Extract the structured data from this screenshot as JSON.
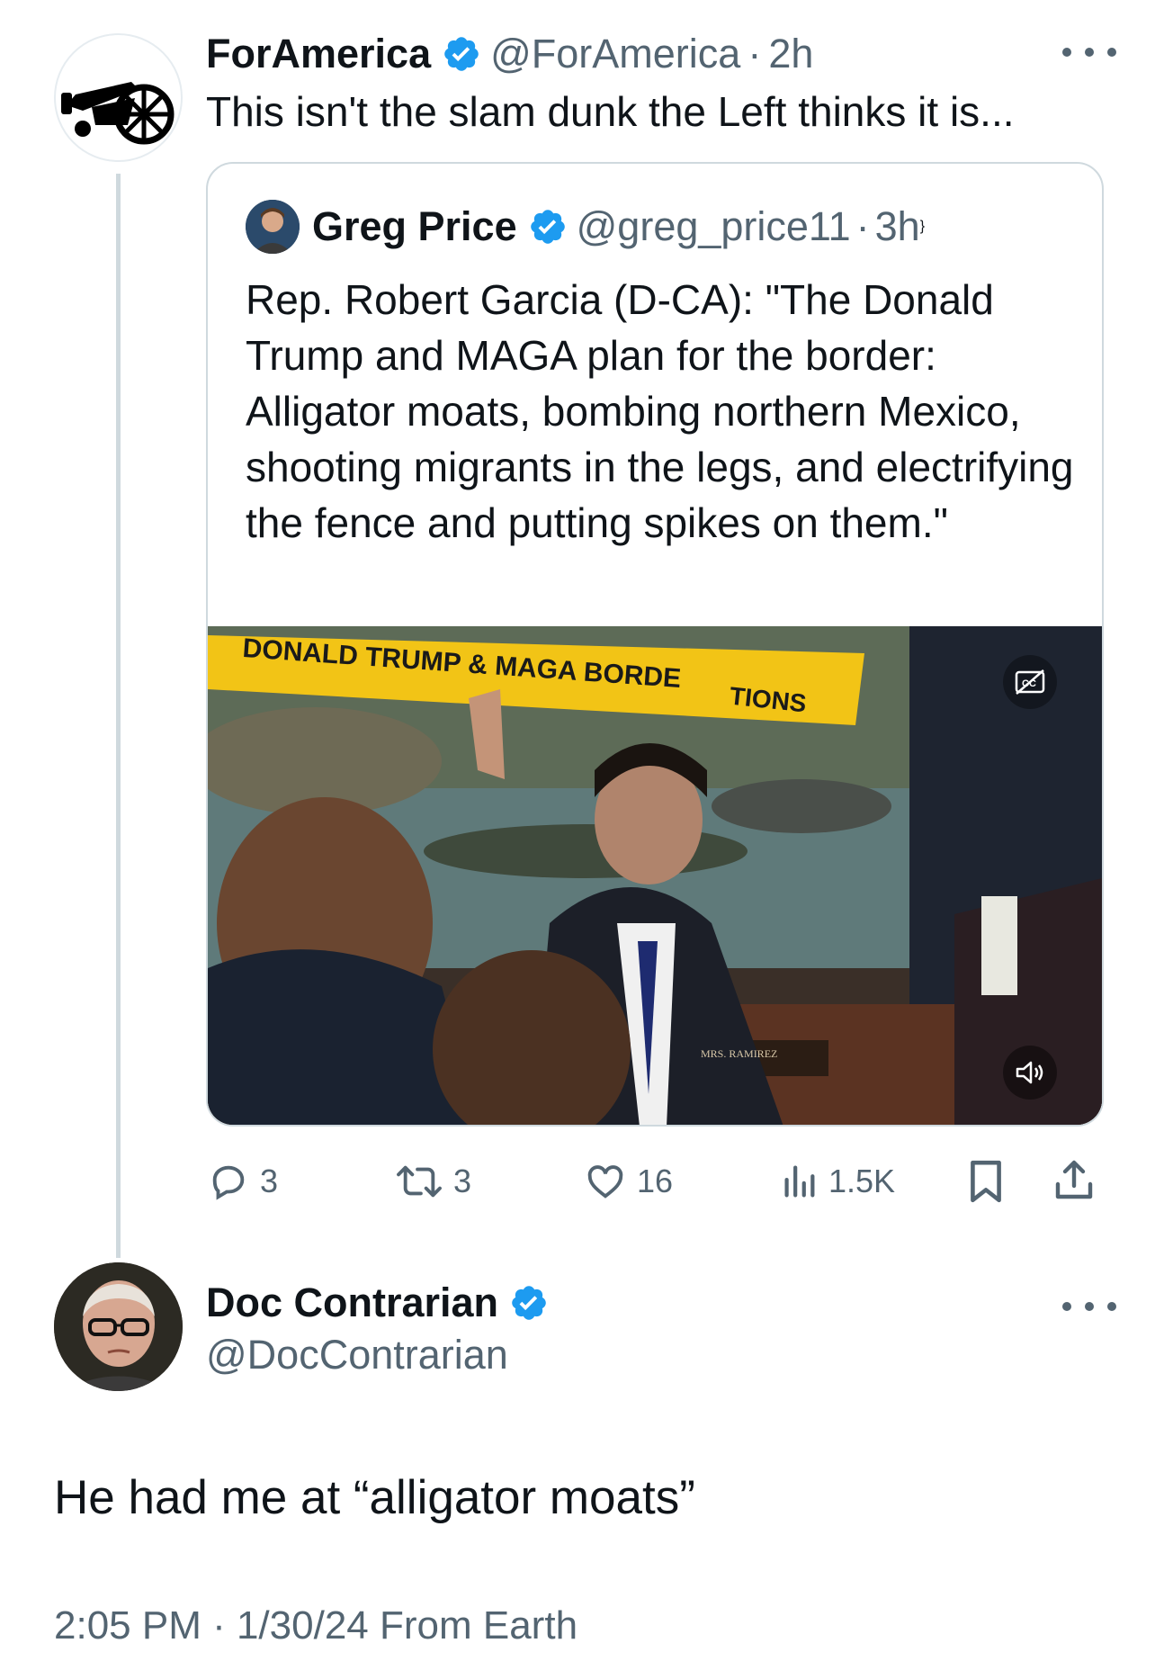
{
  "tweet": {
    "author_name": "ForAmerica",
    "author_handle": "@ForAmerica",
    "separator": "·",
    "time": "2h",
    "text": "This isn't the slam dunk the Left thinks it is...",
    "more_icon": "more-horizontal-icon"
  },
  "quote": {
    "author_name": "Greg Price",
    "author_handle": "@greg_price11",
    "separator": "·",
    "time": "3h",
    "text": "Rep. Robert Garcia (D-CA): \"The Donald Trump and MAGA plan for the border: Alligator moats, bombing northern Mexico, shooting migrants in the legs, and electrifying the fence and putting spikes on them.\"",
    "media": {
      "banner_text": "DONALD TRUMP & MAGA BORDE",
      "banner_text_end": "TIONS",
      "nameplate": "MRS. RAMIREZ"
    }
  },
  "actions": {
    "replies": "3",
    "reposts": "3",
    "likes": "16",
    "views": "1.5K"
  },
  "reply": {
    "author_name": "Doc Contrarian",
    "author_handle": "@DocContrarian",
    "text": "He had me at “alligator moats”",
    "timestamp": "2:05 PM · 1/30/24 From Earth"
  },
  "colors": {
    "verified": "#1d9bf0",
    "text_primary": "#0f1419",
    "text_secondary": "#536471",
    "border": "#cfd9de"
  }
}
